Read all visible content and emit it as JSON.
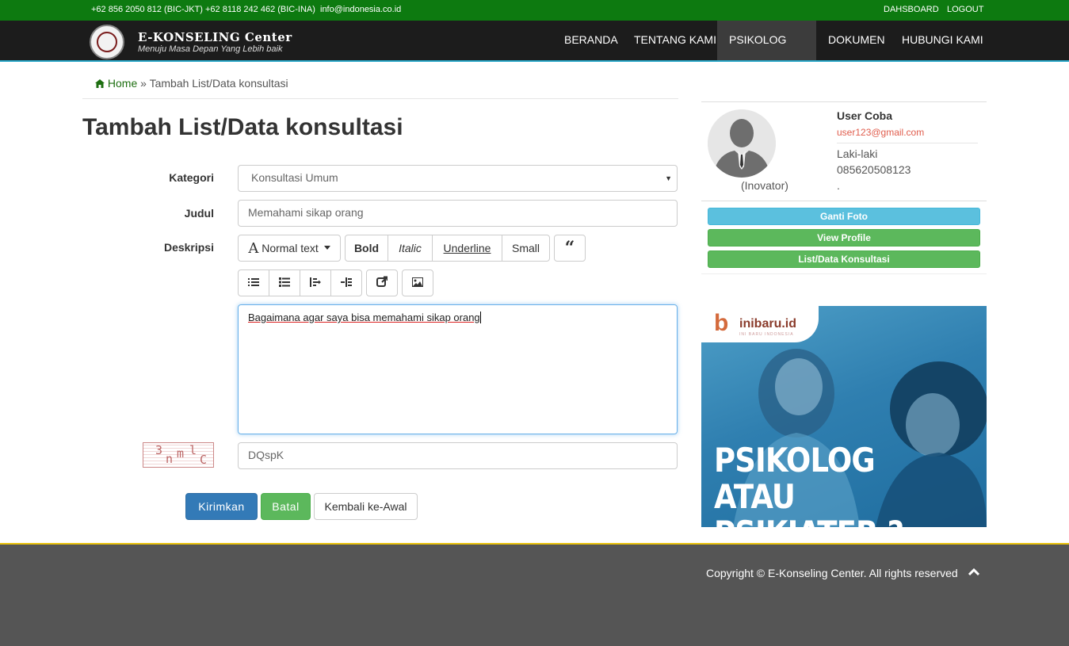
{
  "topbar": {
    "phone_jkt": "+62 856 2050 812 (BIC-JKT)",
    "phone_ina": "+62 8118 242 462 (BIC-INA)",
    "email": "info@indonesia.co.id",
    "dashboard": "DAHSBOARD",
    "logout": "LOGOUT",
    "bg_color": "#0d7a10"
  },
  "navbar": {
    "brand": "E-KONSELING Center",
    "tagline": "Menuju Masa Depan Yang Lebih baik",
    "items": [
      {
        "label": "BERANDA"
      },
      {
        "label": "TENTANG KAMI"
      },
      {
        "label": "PSIKOLOG KAMI"
      },
      {
        "label": "DOKUMEN"
      },
      {
        "label": "HUBUNGI KAMI"
      }
    ],
    "active": "PSIKOLOG KAMI"
  },
  "breadcrumb": {
    "home": "Home",
    "separator": "»",
    "current": "Tambah List/Data konsultasi"
  },
  "page_title": "Tambah List/Data konsultasi",
  "form": {
    "kategori_label": "Kategori",
    "kategori_value": "Konsultasi Umum",
    "judul_label": "Judul",
    "judul_value": "Memahami sikap orang",
    "deskripsi_label": "Deskripsi",
    "toolbar": {
      "font_style": "Normal text",
      "bold": "Bold",
      "italic": "Italic",
      "underline": "Underline",
      "small": "Small"
    },
    "editor_text": "Bagaimana agar saya bisa memahami sikap orang",
    "captcha_text": "3nmlC",
    "captcha_value": "DQspK",
    "submit": "Kirimkan",
    "cancel": "Batal",
    "back": "Kembali ke-Awal"
  },
  "profile": {
    "name": "User Coba",
    "email": "user123@gmail.com",
    "gender": "Laki-laki",
    "phone": "085620508123",
    "extra": ".",
    "role": "(Inovator)",
    "buttons": {
      "ganti_foto": "Ganti Foto",
      "view_profile": "View Profile",
      "list_data": "List/Data Konsultasi"
    }
  },
  "ad": {
    "brand": "inibaru.id",
    "brand_sub": "INI BARU INDONESIA",
    "headline_1": "PSIKOLOG",
    "headline_2": "ATAU PSIKIATER ?"
  },
  "footer": {
    "copyright": "Copyright © E-Konseling Center. All rights reserved",
    "accent": "#e8c10c"
  }
}
